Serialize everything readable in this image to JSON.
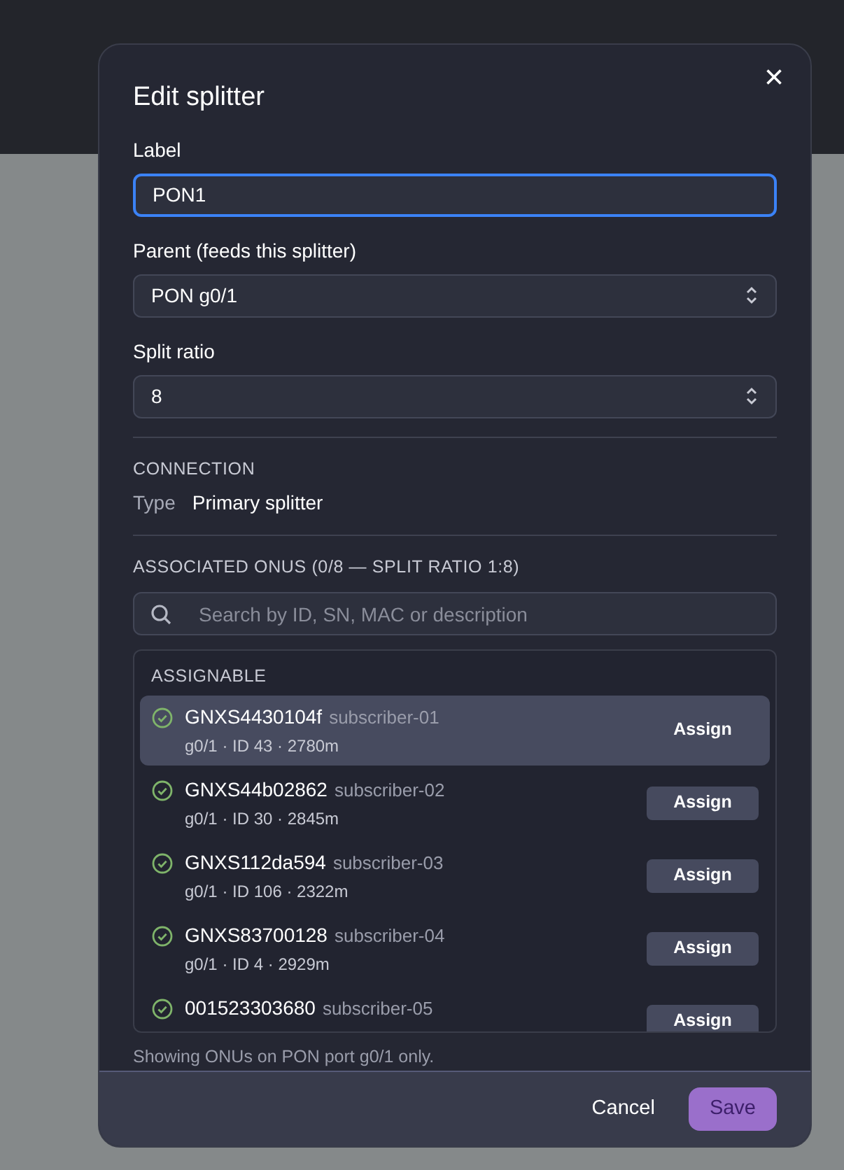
{
  "dialog": {
    "title": "Edit splitter",
    "close": "×"
  },
  "fields": [
    {
      "kind": "text",
      "label": "Label",
      "value": "PON1",
      "focused": true
    },
    {
      "kind": "select",
      "label": "Parent (feeds this splitter)",
      "value": "PON g0/1",
      "focused": false
    },
    {
      "kind": "select",
      "label": "Split ratio",
      "value": "8",
      "focused": false
    }
  ],
  "connection": {
    "heading": "CONNECTION",
    "type_label": "Type",
    "type_value": "Primary splitter"
  },
  "onus": {
    "heading": "ASSOCIATED ONUS (0/8 — SPLIT RATIO 1:8)",
    "search_placeholder": "Search by ID, SN, MAC or description",
    "group": "ASSIGNABLE",
    "items": [
      {
        "serial": "GNXS4430104f",
        "description": "subscriber-01",
        "meta": "g0/1 · ID 43 · 2780m",
        "action": "Assign",
        "selected": true
      },
      {
        "serial": "GNXS44b02862",
        "description": "subscriber-02",
        "meta": "g0/1 · ID 30 · 2845m",
        "action": "Assign",
        "selected": false
      },
      {
        "serial": "GNXS112da594",
        "description": "subscriber-03",
        "meta": "g0/1 · ID 106 · 2322m",
        "action": "Assign",
        "selected": false
      },
      {
        "serial": "GNXS83700128",
        "description": "subscriber-04",
        "meta": "g0/1 · ID 4 · 2929m",
        "action": "Assign",
        "selected": false
      },
      {
        "serial": "001523303680",
        "description": "subscriber-05",
        "action": "Assign",
        "selected": false
      }
    ],
    "note": "Showing ONUs on PON port g0/1 only."
  },
  "buttons": [
    {
      "kind": "secondary",
      "label": "Cancel"
    },
    {
      "kind": "primary",
      "label": "Save"
    }
  ]
}
